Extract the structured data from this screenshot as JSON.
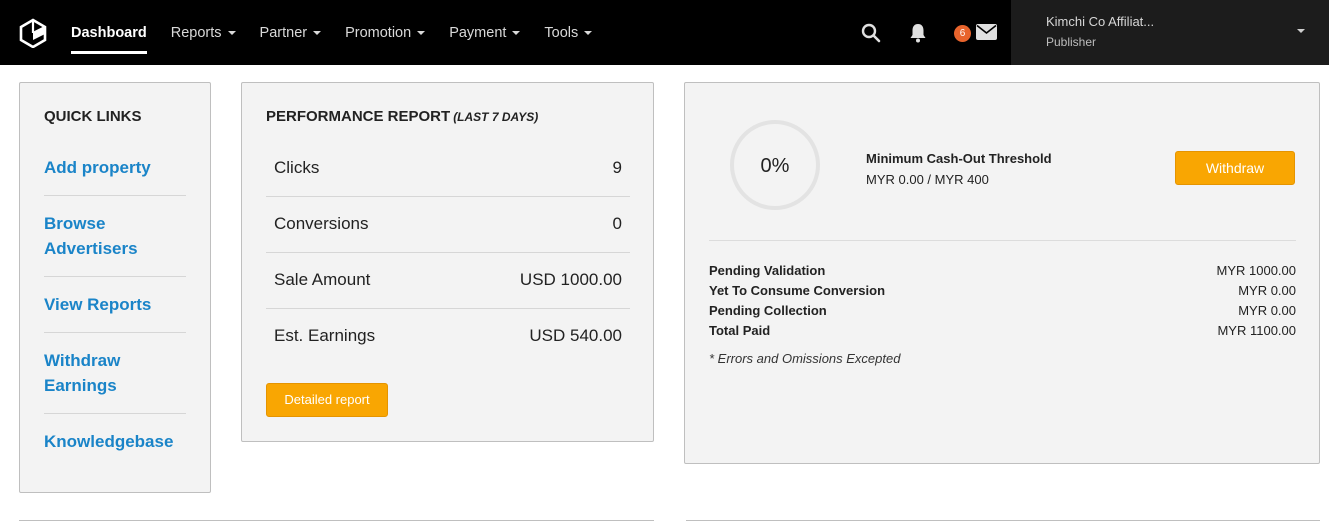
{
  "nav": {
    "items": [
      {
        "label": "Dashboard",
        "active": true,
        "dropdown": false
      },
      {
        "label": "Reports",
        "dropdown": true
      },
      {
        "label": "Partner",
        "dropdown": true
      },
      {
        "label": "Promotion",
        "dropdown": true
      },
      {
        "label": "Payment",
        "dropdown": true
      },
      {
        "label": "Tools",
        "dropdown": true
      }
    ],
    "notification_count": "6",
    "icons": [
      "search-icon",
      "bell-icon",
      "mail-icon"
    ]
  },
  "user": {
    "name": "Kimchi Co Affiliat...",
    "role": "Publisher"
  },
  "quick_links": {
    "title": "QUICK LINKS",
    "items": [
      {
        "label": "Add property"
      },
      {
        "label": "Browse Advertisers"
      },
      {
        "label": "View Reports"
      },
      {
        "label": "Withdraw Earnings"
      },
      {
        "label": "Knowledgebase"
      }
    ]
  },
  "performance": {
    "title": "PERFORMANCE REPORT",
    "subtitle": "(LAST 7 DAYS)",
    "rows": [
      {
        "label": "Clicks",
        "value": "9"
      },
      {
        "label": "Conversions",
        "value": "0"
      },
      {
        "label": "Sale Amount",
        "value": "USD 1000.00"
      },
      {
        "label": "Est. Earnings",
        "value": "USD 540.00"
      }
    ],
    "button_label": "Detailed report"
  },
  "payout": {
    "progress_text": "0%",
    "progress_fraction": 0,
    "threshold_title": "Minimum Cash-Out Threshold",
    "threshold_value": "MYR 0.00 / MYR 400",
    "withdraw_label": "Withdraw",
    "rows": [
      {
        "label": "Pending Validation",
        "value": "MYR 1000.00"
      },
      {
        "label": "Yet To Consume Conversion",
        "value": "MYR 0.00"
      },
      {
        "label": "Pending Collection",
        "value": "MYR 0.00"
      },
      {
        "label": "Total Paid",
        "value": "MYR 1100.00"
      }
    ],
    "note": "* Errors and Omissions Excepted"
  },
  "colors": {
    "accent_orange": "#f9a602",
    "link_blue": "#1a84c8",
    "badge_orange": "#e8642c",
    "topbar": "#000000"
  }
}
